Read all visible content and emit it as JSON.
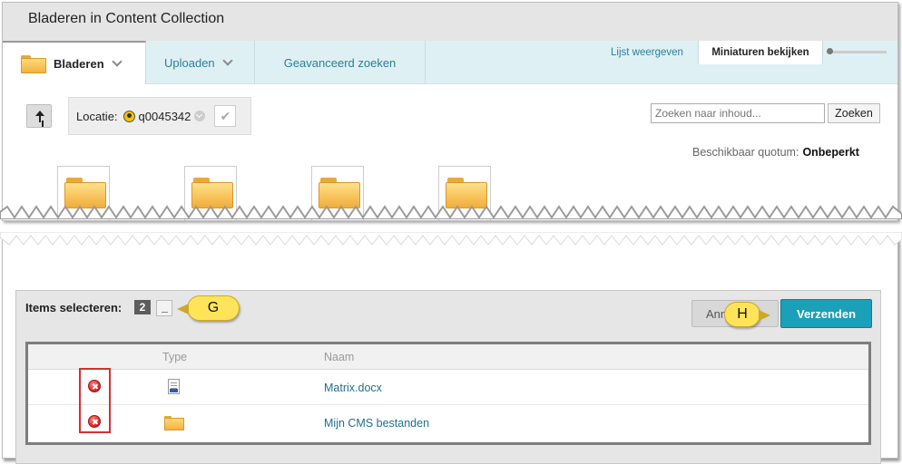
{
  "window": {
    "title": "Bladeren in Content Collection"
  },
  "tabs": {
    "browse_label": "Bladeren",
    "upload_label": "Uploaden",
    "advanced_search_label": "Geavanceerd zoeken",
    "list_view_label": "Lijst weergeven",
    "thumbnail_view_label": "Miniaturen bekijken"
  },
  "location": {
    "label": "Locatie:",
    "value": "q0045342"
  },
  "search": {
    "placeholder": "Zoeken naar inhoud...",
    "button_label": "Zoeken"
  },
  "quota": {
    "label": "Beschikbaar quotum:",
    "value": "Onbeperkt"
  },
  "thumbnails": [
    {
      "icon": "folder-icon"
    },
    {
      "icon": "folder-icon"
    },
    {
      "icon": "folder-icon"
    },
    {
      "icon": "folder-icon"
    }
  ],
  "selection": {
    "label": "Items selecteren:",
    "count": "2",
    "cancel_label": "Annuleren",
    "submit_label": "Verzenden",
    "columns": {
      "type": "Type",
      "name": "Naam"
    },
    "rows": [
      {
        "type_icon": "document-icon",
        "name": "Matrix.docx"
      },
      {
        "type_icon": "folder-icon",
        "name": "Mijn CMS bestanden"
      }
    ]
  },
  "callouts": {
    "g": "G",
    "h": "H"
  },
  "colors": {
    "accent": "#1aa0b8",
    "tab_bar": "#dff0f4",
    "callout": "#ffe45a",
    "highlight_box": "#d43030",
    "link": "#1f6f8b"
  }
}
